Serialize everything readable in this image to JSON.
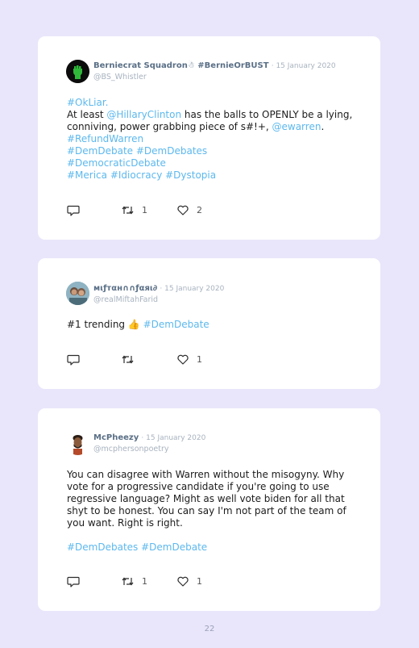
{
  "tweets": [
    {
      "name": "Berniecrat Squadron☃ #BernieOrBUST",
      "date": "· 15 January 2020",
      "handle": "@BS_Whistler",
      "lines": [
        {
          "a": "#OkLiar.",
          "b": "",
          "c": "",
          "d": "",
          "e": ""
        },
        {
          "a": "At least ",
          "b": "@HillaryClinton",
          "c": " has the balls to OPENLY be a lying,",
          "d": "",
          "e": ""
        },
        {
          "a": "conniving, power grabbing piece of s#!+, ",
          "b": "@ewarren",
          "c": ".",
          "d": "",
          "e": ""
        },
        {
          "a": "#RefundWarren",
          "b": "",
          "c": "",
          "d": "",
          "e": ""
        },
        {
          "a": "#DemDebate #DemDebates",
          "b": "",
          "c": "",
          "d": "",
          "e": ""
        },
        {
          "a": "#DemocraticDebate",
          "b": "",
          "c": "",
          "d": "",
          "e": ""
        },
        {
          "a": "#Merica #Idiocracy #Dystopia",
          "b": "",
          "c": "",
          "d": "",
          "e": ""
        }
      ],
      "retweets": "1",
      "likes": "2"
    },
    {
      "name": "мιƒтαн∩∩ƒαяι∂",
      "date": "· 15 January 2020",
      "handle": "@realMiftahFarid",
      "text_plain": "#1 trending 👍 ",
      "text_tag": "#DemDebate",
      "retweets": "",
      "likes": "1"
    },
    {
      "name": "McPheezy",
      "date": "· 15 January 2020",
      "handle": "@mcphersonpoetry",
      "lines": [
        "You can disagree with Warren without the misogyny. Why",
        "vote for a progressive candidate if you're going to use",
        "regressive language? Might as well vote biden for all that",
        "shyt to be honest. You can say I'm not part of the team of",
        "you want. Right is right."
      ],
      "tags": "#DemDebates #DemDebate",
      "retweets": "1",
      "likes": "1"
    }
  ],
  "icons": {
    "reply": "speech-bubble",
    "retweet": "retweet-arrows",
    "like": "heart"
  },
  "colors": {
    "background": "#e9e6fb",
    "card": "#ffffff",
    "link": "#5cb8ee",
    "name": "#5a6f86"
  },
  "page_number": "22"
}
